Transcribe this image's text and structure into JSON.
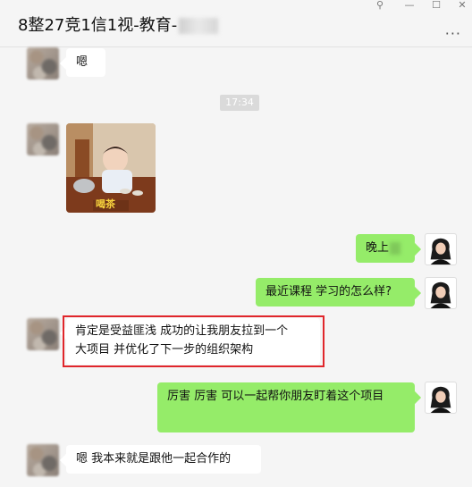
{
  "header": {
    "title": "8整27竞1信1视-教育-"
  },
  "window_controls": {
    "pin": "⚲",
    "minimize": "—",
    "maximize": "☐",
    "close": "✕",
    "more": "···"
  },
  "messages": {
    "m1": {
      "text": "嗯"
    },
    "time": "17:34",
    "photo_caption": "喝茶",
    "m3": {
      "text": "晚上"
    },
    "m4": {
      "text": "最近课程 学习的怎么样?"
    },
    "m5": {
      "line1": "肯定是受益匪浅   成功的让我朋友拉到一个",
      "line2": "大项目   并优化了下一步的组织架构"
    },
    "m6": {
      "text": "厉害 厉害   可以一起帮你朋友盯着这个项目"
    },
    "m7": {
      "text": "嗯  我本来就是跟他一起合作的"
    }
  },
  "colors": {
    "sent_bubble": "#95ec69",
    "received_bubble": "#ffffff",
    "highlight_border": "#e0262b",
    "background": "#f5f5f5"
  }
}
